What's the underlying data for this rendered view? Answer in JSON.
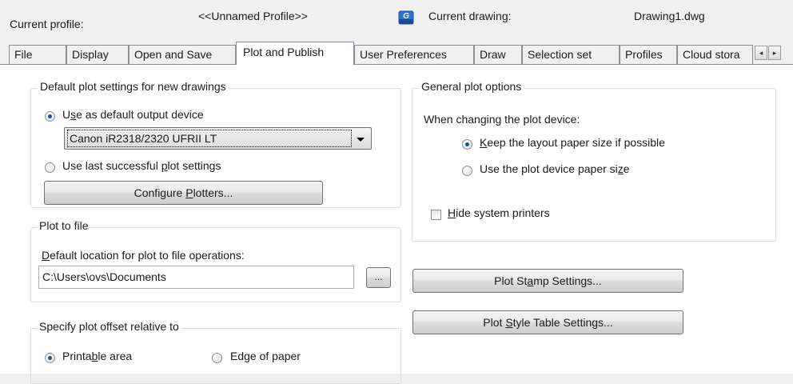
{
  "header": {
    "current_profile_label": "Current profile:",
    "current_profile_value": "<<Unnamed Profile>>",
    "drawing_icon": "dwg-file-icon",
    "current_drawing_label": "Current drawing:",
    "current_drawing_value": "Drawing1.dwg"
  },
  "tabs": [
    {
      "label": "File"
    },
    {
      "label": "Display"
    },
    {
      "label": "Open and Save"
    },
    {
      "label": "Plot and Publish",
      "active": true
    },
    {
      "label": "User Preferences"
    },
    {
      "label": "Draw"
    },
    {
      "label": "Selection set"
    },
    {
      "label": "Profiles"
    },
    {
      "label": "Cloud stora"
    }
  ],
  "tab_scroll": {
    "left_icon": "◂",
    "right_icon": "▸"
  },
  "default_plot": {
    "title": "Default plot settings for new drawings",
    "use_default_pre": "U",
    "use_default_u": "s",
    "use_default_post": "e as default output device",
    "device_value": "Canon iR2318/2320 UFRII LT",
    "use_last_pre": "Use last successful ",
    "use_last_u": "p",
    "use_last_post": "lot settings",
    "configure_pre": "Configure ",
    "configure_u": "P",
    "configure_post": "lotters..."
  },
  "plot_to_file": {
    "title": "Plot to file",
    "location_u": "D",
    "location_post": "efault location for plot to file operations:",
    "path_value": "C:\\Users\\ovs\\Documents",
    "browse_label": "..."
  },
  "plot_offset": {
    "title": "Specify plot offset relative to",
    "printable_pre": "Printa",
    "printable_u": "b",
    "printable_post": "le area",
    "edge_label": "Edge of paper"
  },
  "general": {
    "title": "General plot options",
    "when_changing": "When changing the plot device:",
    "keep_u": "K",
    "keep_post": "eep the layout paper size if possible",
    "use_device_pre": "Use the plot device paper si",
    "use_device_u": "z",
    "use_device_post": "e",
    "hide_u": "H",
    "hide_post": "ide system printers"
  },
  "buttons": {
    "stamp_pre": "Plot St",
    "stamp_u": "a",
    "stamp_post": "mp Settings...",
    "style_pre": "Plot ",
    "style_u": "S",
    "style_post": "tyle Table Settings..."
  },
  "colors": {
    "radio_dot": "#1b4f8f",
    "tab_border": "#898c95",
    "group_border": "#dcdcdc",
    "dialog_bg": "#f0f0f0"
  }
}
